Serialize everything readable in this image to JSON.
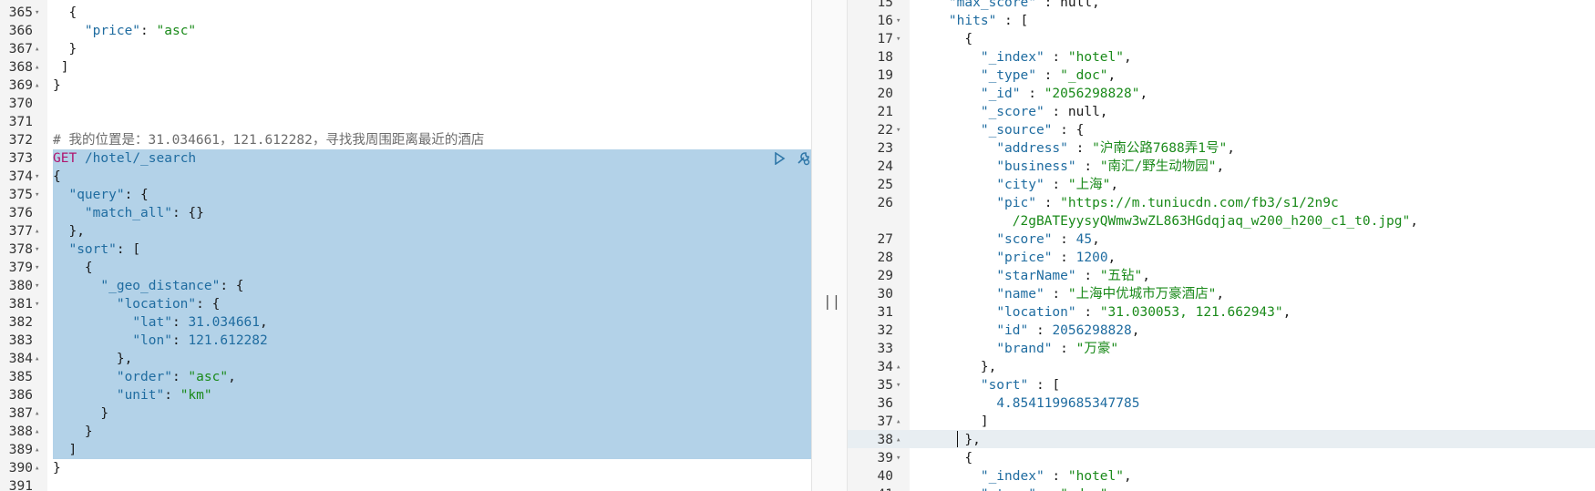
{
  "left_editor": {
    "lines": [
      {
        "num": "365",
        "fold": "▾",
        "html": "<span>  {</span>"
      },
      {
        "num": "366",
        "fold": "",
        "html": "<span>    <span class=\"k\">\"price\"</span>: <span class=\"s\">\"asc\"</span></span>"
      },
      {
        "num": "367",
        "fold": "▴",
        "html": "<span>  }</span>"
      },
      {
        "num": "368",
        "fold": "▴",
        "html": "<span> ]</span>"
      },
      {
        "num": "369",
        "fold": "▴",
        "html": "<span>}</span>"
      },
      {
        "num": "370",
        "fold": "",
        "html": ""
      },
      {
        "num": "371",
        "fold": "",
        "html": ""
      },
      {
        "num": "372",
        "fold": "",
        "html": "<span class=\"c\"># 我的位置是：31.034661，121.612282，寻找我周围距离最近的酒店</span>"
      },
      {
        "num": "373",
        "fold": "",
        "html": "<span><span class=\"m\">GET</span> <span class=\"k\">/hotel/_search</span></span>"
      },
      {
        "num": "374",
        "fold": "▾",
        "html": "<span>{</span>"
      },
      {
        "num": "375",
        "fold": "▾",
        "html": "<span>  <span class=\"k\">\"query\"</span>: {</span>"
      },
      {
        "num": "376",
        "fold": "",
        "html": "<span>    <span class=\"k\">\"match_all\"</span>: {}</span>"
      },
      {
        "num": "377",
        "fold": "▴",
        "html": "<span>  },</span>"
      },
      {
        "num": "378",
        "fold": "▾",
        "html": "<span>  <span class=\"k\">\"sort\"</span>: [</span>"
      },
      {
        "num": "379",
        "fold": "▾",
        "html": "<span>    {</span>"
      },
      {
        "num": "380",
        "fold": "▾",
        "html": "<span>      <span class=\"k\">\"_geo_distance\"</span>: {</span>"
      },
      {
        "num": "381",
        "fold": "▾",
        "html": "<span>        <span class=\"k\">\"location\"</span>: {</span>"
      },
      {
        "num": "382",
        "fold": "",
        "html": "<span>          <span class=\"k\">\"lat\"</span>: <span class=\"n\">31.034661</span>,</span>"
      },
      {
        "num": "383",
        "fold": "",
        "html": "<span>          <span class=\"k\">\"lon\"</span>: <span class=\"n\">121.612282</span></span>"
      },
      {
        "num": "384",
        "fold": "▴",
        "html": "<span>        },</span>"
      },
      {
        "num": "385",
        "fold": "",
        "html": "<span>        <span class=\"k\">\"order\"</span>: <span class=\"s\">\"asc\"</span>,</span>"
      },
      {
        "num": "386",
        "fold": "",
        "html": "<span>        <span class=\"k\">\"unit\"</span>: <span class=\"s\">\"km\"</span></span>"
      },
      {
        "num": "387",
        "fold": "▴",
        "html": "<span>      }</span>"
      },
      {
        "num": "388",
        "fold": "▴",
        "html": "<span>    }</span>"
      },
      {
        "num": "389",
        "fold": "▴",
        "html": "<span>  ]</span>"
      },
      {
        "num": "390",
        "fold": "▴",
        "html": "<span>}</span>"
      },
      {
        "num": "391",
        "fold": "",
        "html": ""
      }
    ]
  },
  "right_editor": {
    "lines": [
      {
        "num": "15",
        "fold": "",
        "html": "<span>    <span class=\"k\">\"max_score\"</span> : null,</span>"
      },
      {
        "num": "16",
        "fold": "▾",
        "html": "<span>    <span class=\"k\">\"hits\"</span> : [</span>"
      },
      {
        "num": "17",
        "fold": "▾",
        "html": "<span>      {</span>"
      },
      {
        "num": "18",
        "fold": "",
        "html": "<span>        <span class=\"k\">\"_index\"</span> : <span class=\"s\">\"hotel\"</span>,</span>"
      },
      {
        "num": "19",
        "fold": "",
        "html": "<span>        <span class=\"k\">\"_type\"</span> : <span class=\"s\">\"_doc\"</span>,</span>"
      },
      {
        "num": "20",
        "fold": "",
        "html": "<span>        <span class=\"k\">\"_id\"</span> : <span class=\"s\">\"2056298828\"</span>,</span>"
      },
      {
        "num": "21",
        "fold": "",
        "html": "<span>        <span class=\"k\">\"_score\"</span> : null,</span>"
      },
      {
        "num": "22",
        "fold": "▾",
        "html": "<span>        <span class=\"k\">\"_source\"</span> : {</span>"
      },
      {
        "num": "23",
        "fold": "",
        "html": "<span>          <span class=\"k\">\"address\"</span> : <span class=\"s\">\"沪南公路7688弄1号\"</span>,</span>"
      },
      {
        "num": "24",
        "fold": "",
        "html": "<span>          <span class=\"k\">\"business\"</span> : <span class=\"s\">\"南汇/野生动物园\"</span>,</span>"
      },
      {
        "num": "25",
        "fold": "",
        "html": "<span>          <span class=\"k\">\"city\"</span> : <span class=\"s\">\"上海\"</span>,</span>"
      },
      {
        "num": "26",
        "fold": "",
        "html": "<span>          <span class=\"k\">\"pic\"</span> : <span class=\"s\">\"https://m.tuniucdn.com/fb3/s1/2n9c</span></span>"
      },
      {
        "num": "",
        "fold": "",
        "html": "<span class=\"s\">            /2gBATEyysyQWmw3wZL863HGdqjaq_w200_h200_c1_t0.jpg\"</span>,"
      },
      {
        "num": "27",
        "fold": "",
        "html": "<span>          <span class=\"k\">\"score\"</span> : <span class=\"n\">45</span>,</span>"
      },
      {
        "num": "28",
        "fold": "",
        "html": "<span>          <span class=\"k\">\"price\"</span> : <span class=\"n\">1200</span>,</span>"
      },
      {
        "num": "29",
        "fold": "",
        "html": "<span>          <span class=\"k\">\"starName\"</span> : <span class=\"s\">\"五钻\"</span>,</span>"
      },
      {
        "num": "30",
        "fold": "",
        "html": "<span>          <span class=\"k\">\"name\"</span> : <span class=\"s\">\"上海中优城市万豪酒店\"</span>,</span>"
      },
      {
        "num": "31",
        "fold": "",
        "html": "<span>          <span class=\"k\">\"location\"</span> : <span class=\"s\">\"31.030053, 121.662943\"</span>,</span>"
      },
      {
        "num": "32",
        "fold": "",
        "html": "<span>          <span class=\"k\">\"id\"</span> : <span class=\"n\">2056298828</span>,</span>"
      },
      {
        "num": "33",
        "fold": "",
        "html": "<span>          <span class=\"k\">\"brand\"</span> : <span class=\"s\">\"万豪\"</span></span>"
      },
      {
        "num": "34",
        "fold": "▴",
        "html": "<span>        },</span>"
      },
      {
        "num": "35",
        "fold": "▾",
        "html": "<span>        <span class=\"k\">\"sort\"</span> : [</span>"
      },
      {
        "num": "36",
        "fold": "",
        "html": "<span>          <span class=\"n\">4.8541199685347785</span></span>"
      },
      {
        "num": "37",
        "fold": "▴",
        "html": "<span>        ]</span>"
      },
      {
        "num": "38",
        "fold": "▴",
        "html": "<span>      },</span>"
      },
      {
        "num": "39",
        "fold": "▾",
        "html": "<span>      {</span>"
      },
      {
        "num": "40",
        "fold": "",
        "html": "<span>        <span class=\"k\">\"_index\"</span> : <span class=\"s\">\"hotel\"</span>,</span>"
      },
      {
        "num": "41",
        "fold": "",
        "html": "<span>        <span class=\"k\">\"_type\"</span> : <span class=\"s\">\"_doc\"</span>,</span>"
      }
    ]
  },
  "divider": {
    "handle": "||"
  },
  "actions": {
    "run": "run-icon",
    "wrench": "wrench-icon"
  }
}
